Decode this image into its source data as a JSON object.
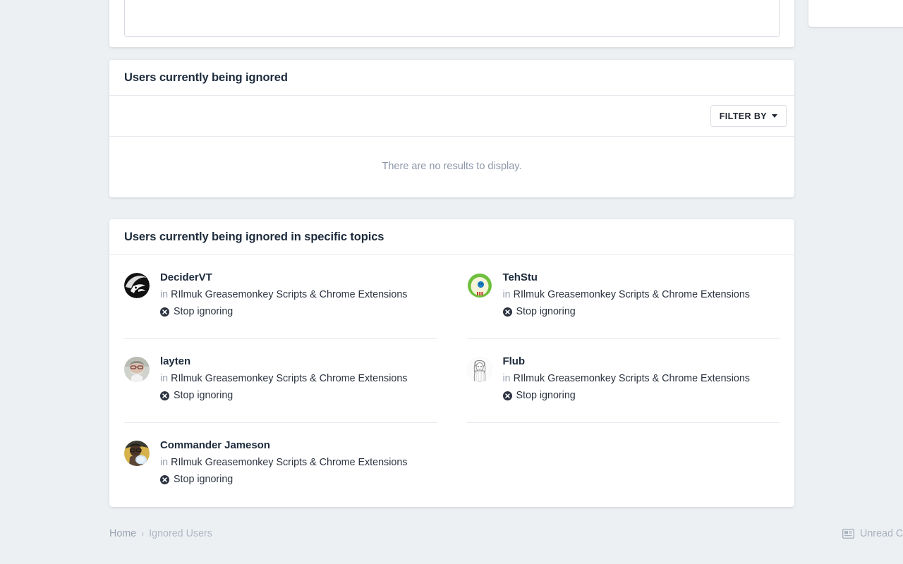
{
  "cards": {
    "ignored": {
      "title": "Users currently being ignored",
      "filter_label": "FILTER BY",
      "empty_message": "There are no results to display."
    },
    "topics": {
      "title": "Users currently being ignored in specific topics"
    }
  },
  "users": [
    {
      "name": "DeciderVT",
      "in_label": "in",
      "topic": "RIlmuk Greasemonkey Scripts & Chrome Extensions",
      "stop_label": "Stop ignoring",
      "avatar": "deciderv t-avatar"
    },
    {
      "name": "TehStu",
      "in_label": "in",
      "topic": "RIlmuk Greasemonkey Scripts & Chrome Extensions",
      "stop_label": "Stop ignoring",
      "avatar": "tehstu-avatar"
    },
    {
      "name": "layten",
      "in_label": "in",
      "topic": "RIlmuk Greasemonkey Scripts & Chrome Extensions",
      "stop_label": "Stop ignoring",
      "avatar": "layten-avatar"
    },
    {
      "name": "Flub",
      "in_label": "in",
      "topic": "RIlmuk Greasemonkey Scripts & Chrome Extensions",
      "stop_label": "Stop ignoring",
      "avatar": "flub-avatar"
    },
    {
      "name": "Commander Jameson",
      "in_label": "in",
      "topic": "RIlmuk Greasemonkey Scripts & Chrome Extensions",
      "stop_label": "Stop ignoring",
      "avatar": "commander-jameson-avatar"
    }
  ],
  "footer": {
    "breadcrumb_home": "Home",
    "breadcrumb_separator": "›",
    "breadcrumb_current": "Ignored Users",
    "unread_label": "Unread C"
  },
  "colors": {
    "page_background": "#edf0f3",
    "card_background": "#ffffff",
    "heading": "#1d2b3c",
    "muted_text": "#8d96a8",
    "divider": "#e8eaef",
    "accent_pill": "#e6eef8"
  }
}
